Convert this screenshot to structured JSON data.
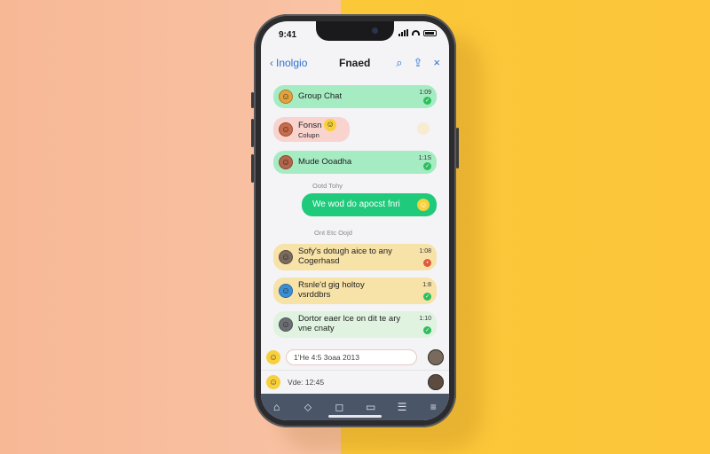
{
  "status_bar": {
    "time": "9:41"
  },
  "nav": {
    "back_label": "Inolgio",
    "title": "Fnaed"
  },
  "chats": [
    {
      "name": "Group Chat",
      "sub": "",
      "time": "1:09",
      "avatar": "☺",
      "avatar_color": "#e5a23b",
      "bubble_color": "#a6ecc3",
      "status": "green"
    },
    {
      "name": "Fonsn",
      "sub": "Colupn",
      "time": "",
      "avatar": "☺",
      "avatar_color": "#c86c4b",
      "bubble_color": "#f9d4cf",
      "status": ""
    },
    {
      "name": "Mude Ooadha",
      "sub": "",
      "time": "1:1S",
      "avatar": "☺",
      "avatar_color": "#b5654a",
      "bubble_color": "#a6ecc3",
      "status": "green"
    }
  ],
  "label_1": "Ootd Tohy",
  "outgoing": {
    "text": "We wod do apocst fnri"
  },
  "label_2": "Ont Etc Oojd",
  "threads": [
    {
      "line1": "Sofy's dotugh aice to any",
      "line2": "Cogerhasd",
      "time": "1:08",
      "avatar": "☺",
      "avatar_color": "#7a6b5e",
      "status": "red"
    },
    {
      "line1": "Rsnle'd gig holtoy",
      "line2": "vsrddbrs",
      "time": "1:8",
      "avatar": "☺",
      "avatar_color": "#3a8fd6",
      "status": "green"
    },
    {
      "line1": "Dortor eaer lce on dit te ary",
      "line2": "vne cnaty",
      "time": "1:10",
      "avatar": "☺",
      "avatar_color": "#6b6f74",
      "status": "green"
    }
  ],
  "composer_1": {
    "placeholder": "1'He 4:5 3oaa 2013"
  },
  "composer_2": {
    "placeholder": "Vde: 12:45"
  },
  "tabs": [
    "⌂",
    "⬦",
    "◻",
    "▭",
    "☰",
    "≡"
  ],
  "colors": {
    "accent": "#2e6fd6",
    "green": "#2bbf5d",
    "outgoing": "#1fca7b",
    "tabbar": "#4b5568"
  }
}
